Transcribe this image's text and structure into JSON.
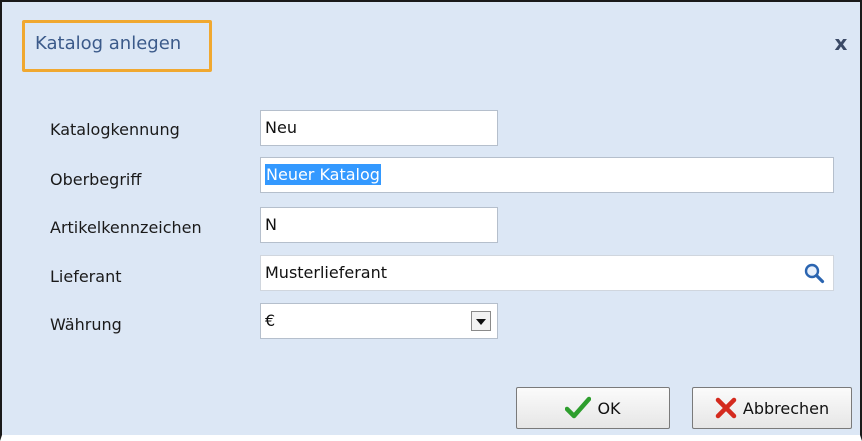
{
  "dialog": {
    "title": "Katalog anlegen",
    "close_glyph": "x"
  },
  "form": {
    "katalogkennung": {
      "label": "Katalogkennung",
      "value": "Neu"
    },
    "oberbegriff": {
      "label": "Oberbegriff",
      "value": "Neuer Katalog"
    },
    "artikelkennzeichen": {
      "label": "Artikelkennzeichen",
      "value": "N"
    },
    "lieferant": {
      "label": "Lieferant",
      "value": "Musterlieferant",
      "icon": "search-icon"
    },
    "waehrung": {
      "label": "Währung",
      "value": "€",
      "icon": "chevron-down-icon"
    }
  },
  "buttons": {
    "ok": {
      "label": "OK",
      "icon": "check-icon",
      "icon_color": "#2e9e2e"
    },
    "cancel": {
      "label": "Abbrechen",
      "icon": "cross-icon",
      "icon_color": "#d42a1e"
    }
  },
  "colors": {
    "dialog_bg": "#dce7f5",
    "title_text": "#3b5a8a",
    "title_highlight": "#f0a830",
    "selection": "#3399ff"
  }
}
